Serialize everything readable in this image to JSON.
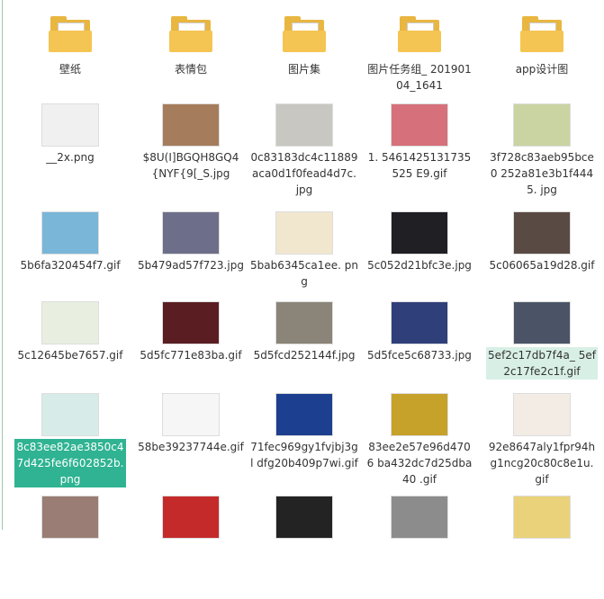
{
  "files": [
    {
      "label": "壁纸",
      "kind": "folder"
    },
    {
      "label": "表情包",
      "kind": "folder"
    },
    {
      "label": "图片集",
      "kind": "folder"
    },
    {
      "label": "图片任务组_ 20190104_1641",
      "kind": "folder"
    },
    {
      "label": "app设计图",
      "kind": "folder"
    },
    {
      "label": "__2x.png",
      "kind": "image",
      "color": "#f0f0f0"
    },
    {
      "label": "$8U(I]BGQH8GQ4 {NYF{9[_S.jpg",
      "kind": "image",
      "color": "#a57d5c"
    },
    {
      "label": "0c83183dc4c11889 aca0d1f0fead4d7c. jpg",
      "kind": "image",
      "color": "#c9c7c2"
    },
    {
      "label": "1. 5461425131735525 E9.gif",
      "kind": "image",
      "color": "#d6707a"
    },
    {
      "label": "3f728c83aeb95bce0 252a81e3b1f4445. jpg",
      "kind": "image",
      "color": "#c9d4a2"
    },
    {
      "label": "5b6fa320454f7.gif",
      "kind": "image",
      "color": "#7ab6d8"
    },
    {
      "label": "5b479ad57f723.jpg",
      "kind": "image",
      "color": "#6d6f8a"
    },
    {
      "label": "5bab6345ca1ee. png",
      "kind": "image",
      "color": "#f1e7cf"
    },
    {
      "label": "5c052d21bfc3e.jpg",
      "kind": "image",
      "color": "#1f1f24"
    },
    {
      "label": "5c06065a19d28.gif",
      "kind": "image",
      "color": "#5a4a44"
    },
    {
      "label": "5c12645be7657.gif",
      "kind": "image",
      "color": "#e8efe0"
    },
    {
      "label": "5d5fc771e83ba.gif",
      "kind": "image",
      "color": "#5a1e22"
    },
    {
      "label": "5d5fcd252144f.jpg",
      "kind": "image",
      "color": "#8a8578"
    },
    {
      "label": "5d5fce5c68733.jpg",
      "kind": "image",
      "color": "#2f3f7a"
    },
    {
      "label": "5ef2c17db7f4a_ 5ef2c17fe2c1f.gif",
      "kind": "image",
      "color": "#4a5466",
      "selected": "light"
    },
    {
      "label": "8c83ee82ae3850c4 7d425fe6f602852b. png",
      "kind": "image",
      "color": "#d7ece8",
      "selected": "dark"
    },
    {
      "label": "58be39237744e.gif",
      "kind": "image",
      "color": "#f6f6f6"
    },
    {
      "label": "71fec969gy1fvjbj3gl dfg20b409p7wi.gif",
      "kind": "image",
      "color": "#1d3f8f"
    },
    {
      "label": "83ee2e57e96d4706 ba432dc7d25dba40 .gif",
      "kind": "image",
      "color": "#c7a22a"
    },
    {
      "label": "92e8647aly1fpr94h g1ncg20c80c8e1u. gif",
      "kind": "image",
      "color": "#f2ece4"
    },
    {
      "label": "",
      "kind": "image",
      "color": "#9a7d74"
    },
    {
      "label": "",
      "kind": "image",
      "color": "#c42a2a"
    },
    {
      "label": "",
      "kind": "image",
      "color": "#232323"
    },
    {
      "label": "",
      "kind": "image",
      "color": "#8c8c8c"
    },
    {
      "label": "",
      "kind": "image",
      "color": "#e9d27a"
    }
  ]
}
